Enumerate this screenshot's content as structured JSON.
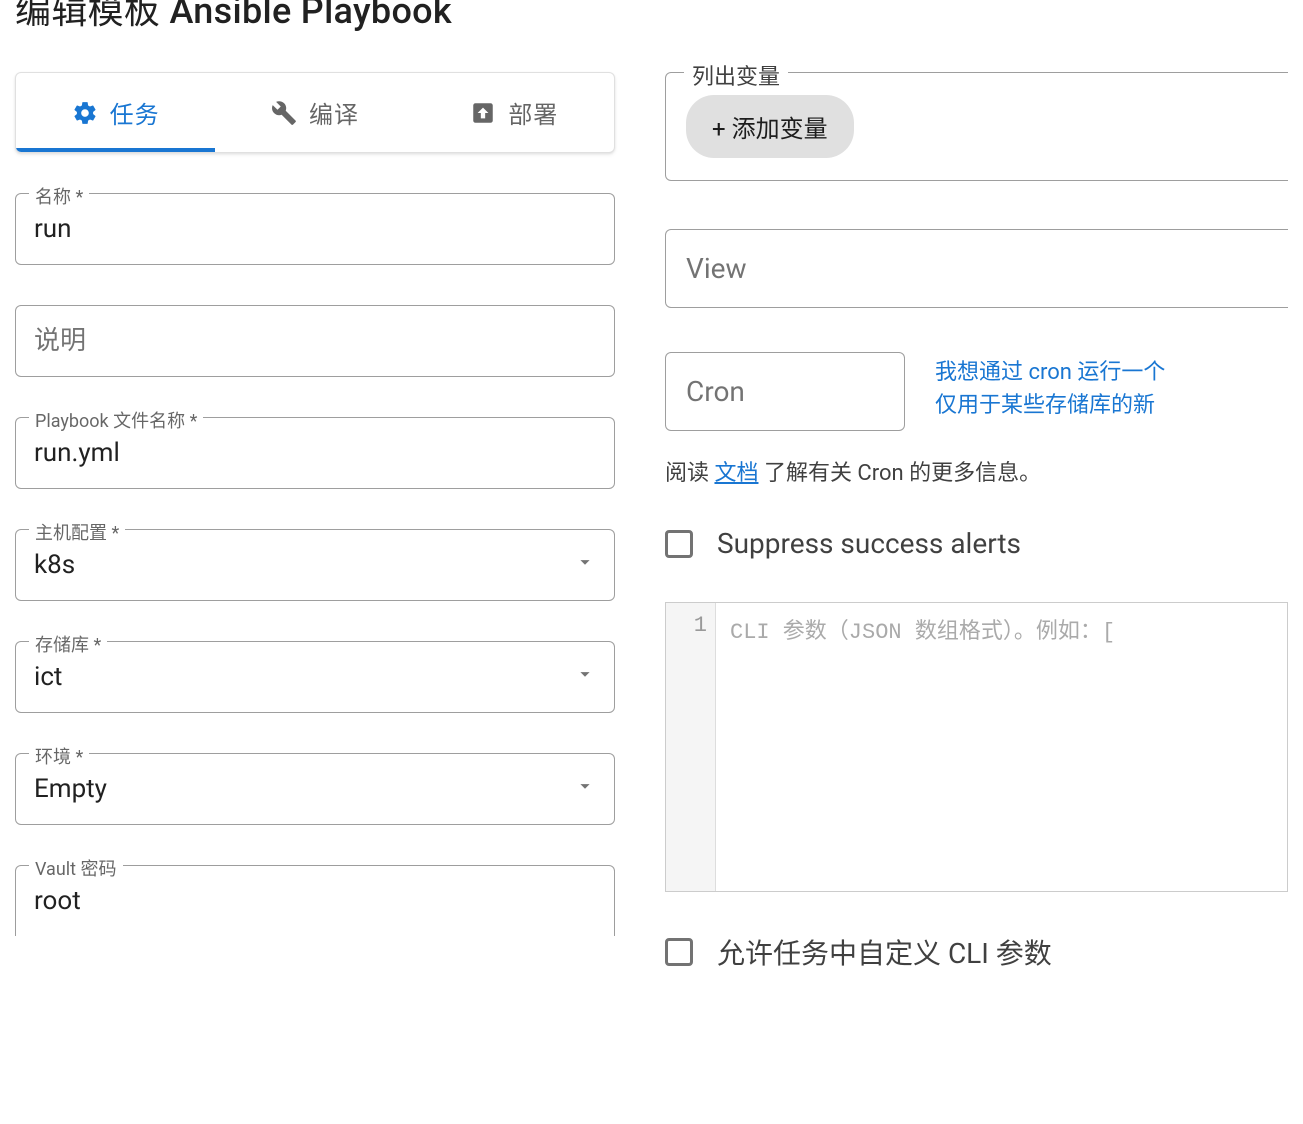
{
  "header": {
    "title": "编辑模板 Ansible Playbook"
  },
  "tabs": {
    "task": "任务",
    "build": "编译",
    "deploy": "部署"
  },
  "fields": {
    "name": {
      "label": "名称 *",
      "value": "run"
    },
    "description": {
      "placeholder": "说明"
    },
    "playbook": {
      "label": "Playbook 文件名称 *",
      "value": "run.yml"
    },
    "inventory": {
      "label": "主机配置 *",
      "value": "k8s"
    },
    "repository": {
      "label": "存储库 *",
      "value": "ict"
    },
    "environment": {
      "label": "环境 *",
      "value": "Empty"
    },
    "vault": {
      "label": "Vault 密码",
      "value": "root"
    }
  },
  "right": {
    "variables": {
      "legend": "列出变量",
      "add_chip": "+ 添加变量"
    },
    "view": {
      "placeholder": "View"
    },
    "cron": {
      "placeholder": "Cron",
      "help_line1": "我想通过 cron 运行一个",
      "help_line2": "仅用于某些存储库的新",
      "doc_prefix": "阅读 ",
      "doc_link": "文档",
      "doc_suffix": " 了解有关 Cron 的更多信息。"
    },
    "suppress_alerts": "Suppress success alerts",
    "cli_editor": {
      "line_no": "1",
      "placeholder": "CLI 参数（JSON 数组格式）。例如：["
    },
    "allow_cli_override": "允许任务中自定义 CLI 参数"
  }
}
